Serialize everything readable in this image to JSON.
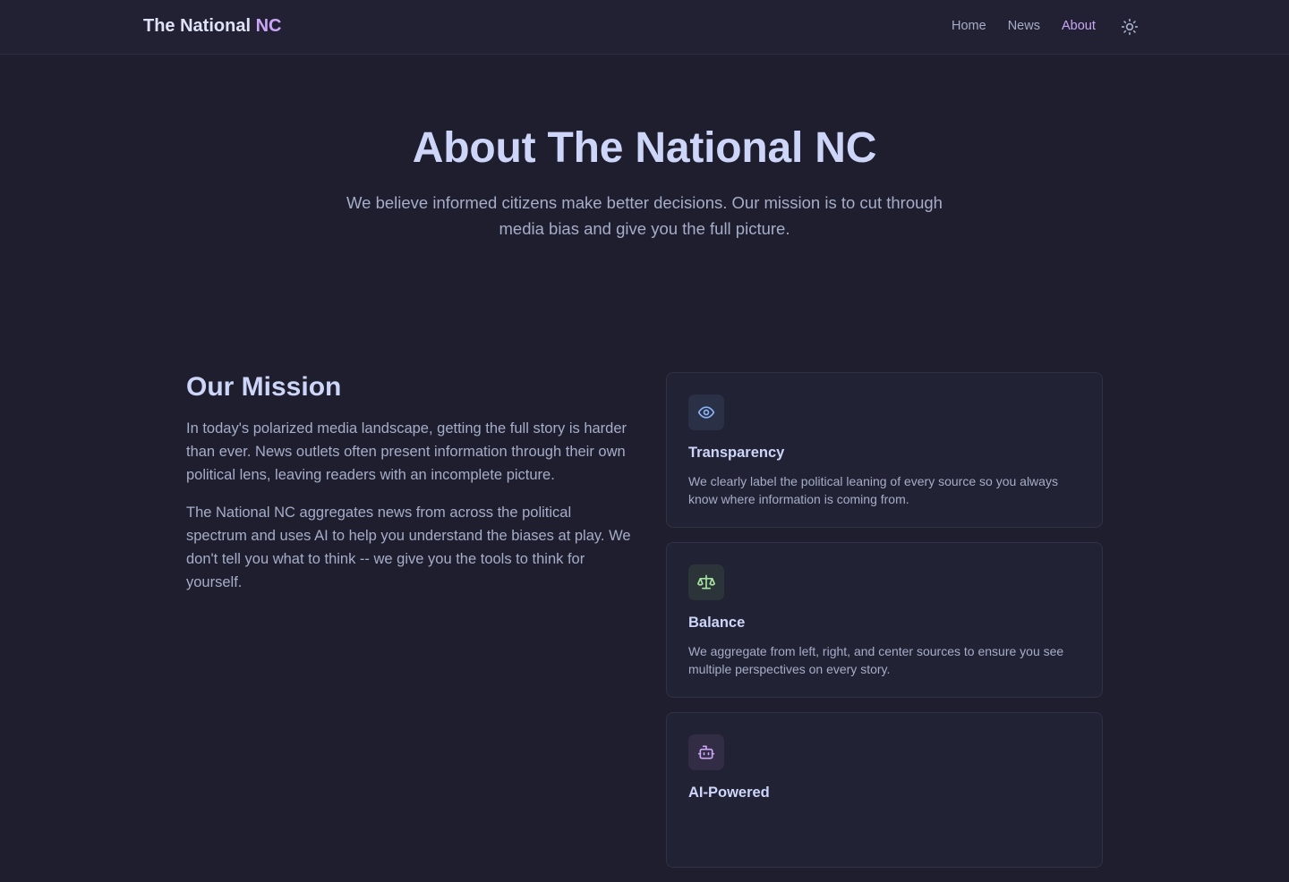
{
  "nav": {
    "brand_main": "The National ",
    "brand_accent": "NC",
    "links": [
      {
        "label": "Home"
      },
      {
        "label": "News"
      },
      {
        "label": "About"
      }
    ],
    "theme_icon": "sun-icon"
  },
  "hero": {
    "title": "About The National NC",
    "subtitle": "We believe informed citizens make better decisions. Our mission is to cut through media bias and give you the full picture."
  },
  "mission": {
    "title": "Our Mission",
    "paragraphs": [
      "In today's polarized media landscape, getting the full story is harder than ever. News outlets often present information through their own political lens, leaving readers with an incomplete picture.",
      "The National NC aggregates news from across the political spectrum and uses AI to help you understand the biases at play. We don't tell you what to think -- we give you the tools to think for yourself."
    ]
  },
  "values": [
    {
      "icon": "eye-icon",
      "title": "Transparency",
      "text": "We clearly label the political leaning of every source so you always know where information is coming from.",
      "color": "#89b4fa"
    },
    {
      "icon": "scale-icon",
      "title": "Balance",
      "text": "We aggregate from left, right, and center sources to ensure you see multiple perspectives on every story.",
      "color": "#a6e3a1"
    },
    {
      "icon": "bot-icon",
      "title": "AI-Powered",
      "text": "",
      "color": "#cba6f7"
    }
  ],
  "colors": {
    "background": "#1e1e2e",
    "accent": "#cba6f7",
    "text": "#cdd6f4",
    "muted": "#a6adc8"
  }
}
